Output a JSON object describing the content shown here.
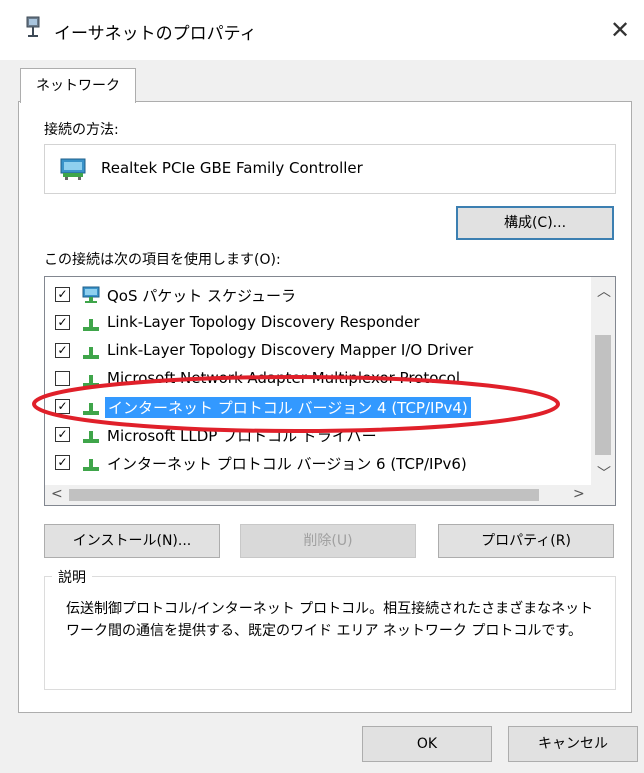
{
  "window": {
    "title": "イーサネットのプロパティ",
    "close_glyph": "✕"
  },
  "tab": {
    "label": "ネットワーク"
  },
  "connect_using": {
    "label": "接続の方法:",
    "adapter": "Realtek PCIe GBE Family Controller"
  },
  "configure_button": "構成(C)...",
  "items_label": "この接続は次の項目を使用します(O):",
  "items": [
    {
      "label": "QoS パケット スケジューラ",
      "checked": true,
      "icon": "network-icon"
    },
    {
      "label": "Link-Layer Topology Discovery Responder",
      "checked": true,
      "icon": "protocol-icon"
    },
    {
      "label": "Link-Layer Topology Discovery Mapper I/O Driver",
      "checked": true,
      "icon": "protocol-icon"
    },
    {
      "label": "Microsoft Network Adapter Multiplexor Protocol",
      "checked": false,
      "icon": "protocol-icon"
    },
    {
      "label": "インターネット プロトコル バージョン 4 (TCP/IPv4)",
      "checked": true,
      "icon": "protocol-icon",
      "selected": true
    },
    {
      "label": "Microsoft LLDP プロトコル ドライバー",
      "checked": true,
      "icon": "protocol-icon"
    },
    {
      "label": "インターネット プロトコル バージョン 6 (TCP/IPv6)",
      "checked": true,
      "icon": "protocol-icon"
    }
  ],
  "buttons": {
    "install": "インストール(N)...",
    "uninstall": "削除(U)",
    "properties": "プロパティ(R)"
  },
  "description": {
    "title": "説明",
    "text": "伝送制御プロトコル/インターネット プロトコル。相互接続されたさまざまなネットワーク間の通信を提供する、既定のワイド エリア ネットワーク プロトコルです。"
  },
  "footer": {
    "ok": "OK",
    "cancel": "キャンセル"
  },
  "colors": {
    "selection": "#3399ff",
    "annotation": "#e0202a",
    "accent": "#3c7fb1"
  }
}
